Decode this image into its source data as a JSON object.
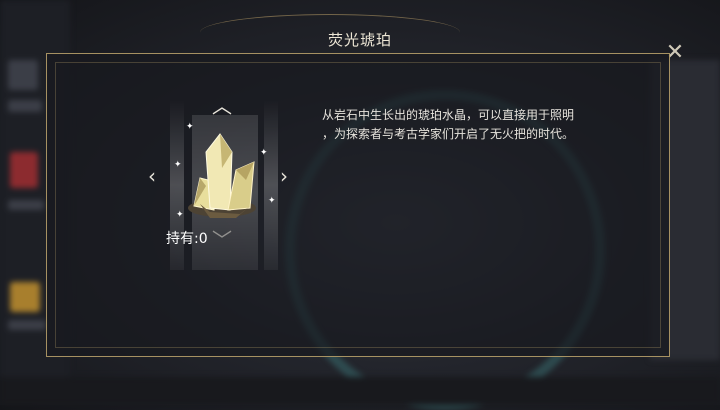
{
  "dialog": {
    "title": "荧光琥珀",
    "close_icon": "close-icon"
  },
  "item": {
    "name_icon": "amber-crystal-icon",
    "owned_label": "持有:",
    "owned_count": "0",
    "description_line1": "从岩石中生长出的琥珀水晶，可以直接用于照明",
    "description_line2": "，为探索者与考古学家们开启了无火把的时代。"
  },
  "colors": {
    "frame": "#d6ba78",
    "text": "#e6e3dc",
    "crystal": "#e7dc9a"
  }
}
